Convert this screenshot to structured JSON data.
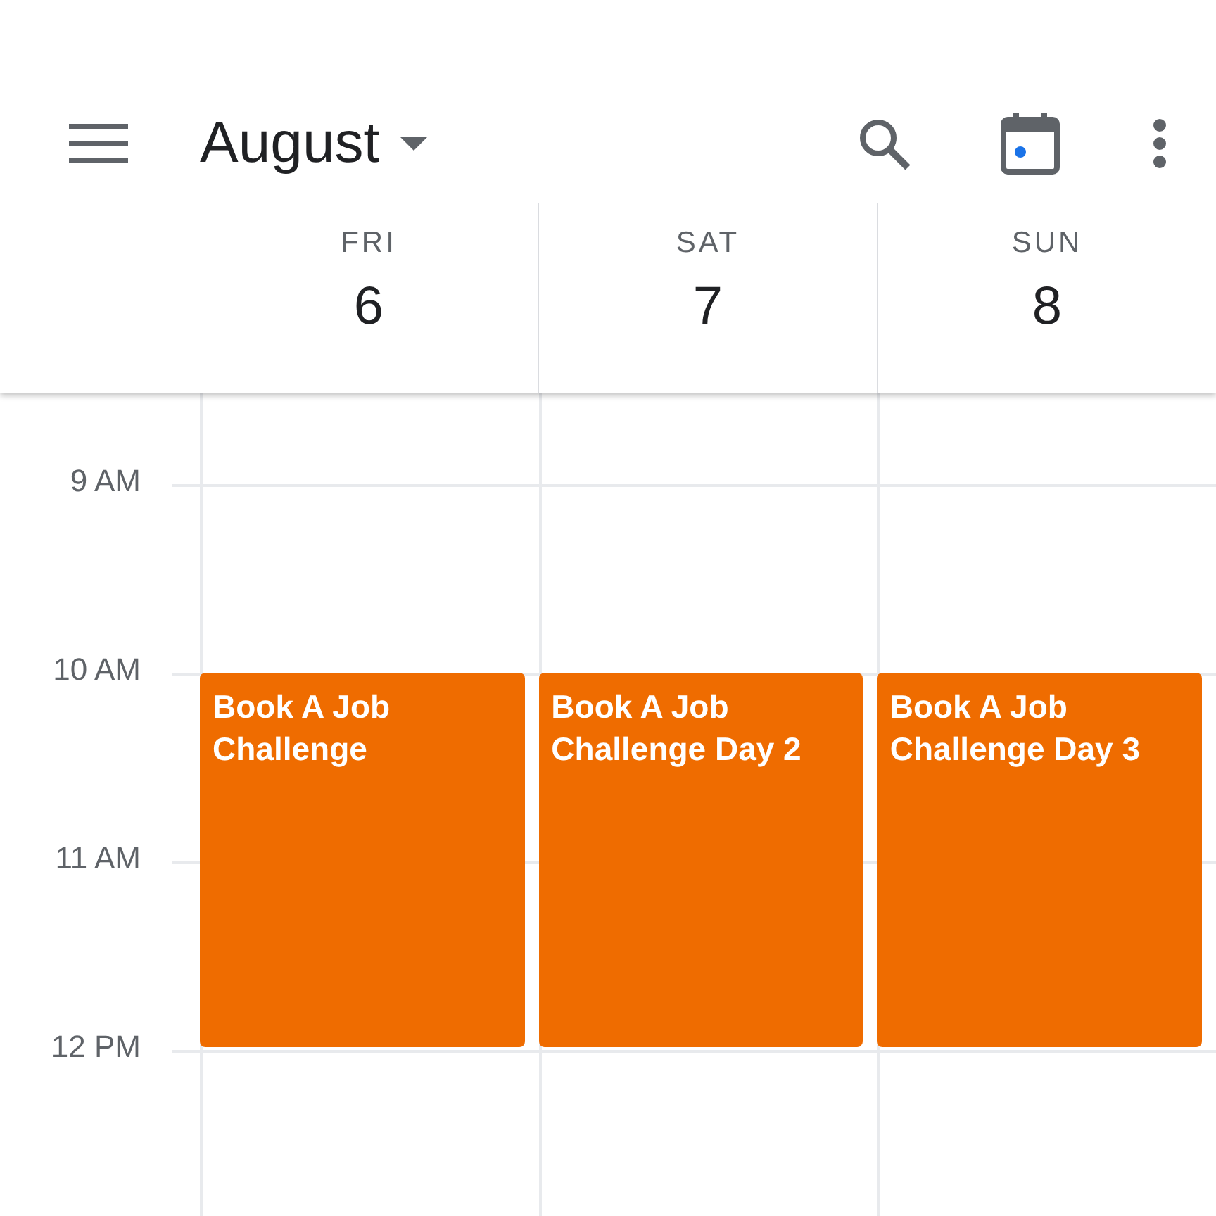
{
  "toolbar": {
    "month": "August"
  },
  "days": [
    {
      "weekday": "FRI",
      "date": "6",
      "events": [
        {
          "title": "Book A Job Challenge",
          "color": "#ef6c00"
        }
      ]
    },
    {
      "weekday": "SAT",
      "date": "7",
      "events": [
        {
          "title": "Book A Job Challenge Day 2",
          "color": "#ef6c00"
        }
      ]
    },
    {
      "weekday": "SUN",
      "date": "8",
      "events": [
        {
          "title": "Book A Job Challenge Day 3",
          "color": "#ef6c00"
        }
      ]
    }
  ],
  "hours": [
    "9 AM",
    "10 AM",
    "11 AM",
    "12 PM"
  ]
}
